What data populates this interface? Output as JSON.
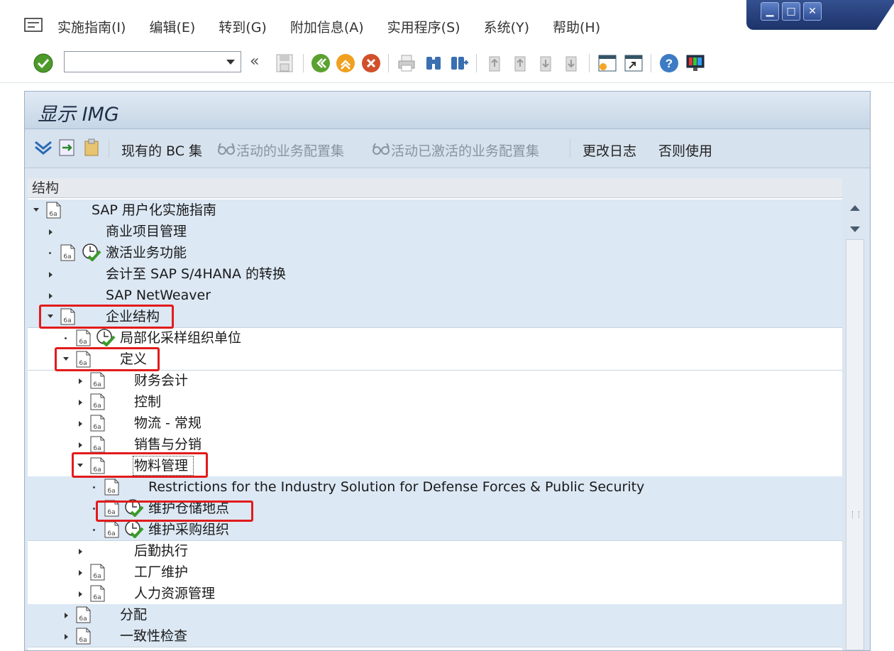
{
  "menubar": {
    "items": [
      {
        "label": "实施指南(I)"
      },
      {
        "label": "编辑(E)"
      },
      {
        "label": "转到(G)"
      },
      {
        "label": "附加信息(A)"
      },
      {
        "label": "实用程序(S)"
      },
      {
        "label": "系统(Y)"
      },
      {
        "label": "帮助(H)"
      }
    ],
    "window_controls": {
      "minimize": "▁",
      "maximize": "□",
      "close": "✕"
    }
  },
  "toolbar": {
    "command_field": {
      "value": "",
      "placeholder": ""
    },
    "back_chevrons": "«"
  },
  "panel": {
    "title": "显示 IMG",
    "app_toolbar": {
      "existing_bc_sets": "现有的 BC 集",
      "active_bc_sets": "活动的业务配置集",
      "activated_bc_sets": "活动已激活的业务配置集",
      "change_log": "更改日志",
      "otherwise_use": "否则使用"
    },
    "tree": {
      "header": "结构",
      "nodes": [
        {
          "label": "SAP 用户化实施指南"
        },
        {
          "label": "商业项目管理"
        },
        {
          "label": "激活业务功能"
        },
        {
          "label": "会计至 SAP S/4HANA 的转换"
        },
        {
          "label": "SAP NetWeaver"
        },
        {
          "label": "企业结构"
        },
        {
          "label": "局部化采样组织单位"
        },
        {
          "label": "定义"
        },
        {
          "label": "财务会计"
        },
        {
          "label": "控制"
        },
        {
          "label": "物流 - 常规"
        },
        {
          "label": "销售与分销"
        },
        {
          "label": "物料管理"
        },
        {
          "label": "Restrictions for the Industry Solution for Defense Forces & Public Security"
        },
        {
          "label": "维护仓储地点"
        },
        {
          "label": "维护采购组织"
        },
        {
          "label": "后勤执行"
        },
        {
          "label": "工厂维护"
        },
        {
          "label": "人力资源管理"
        },
        {
          "label": "分配"
        },
        {
          "label": "一致性检查"
        }
      ]
    }
  },
  "colors": {
    "highlight_box": "#e21b1b",
    "panel_bg": "#dbe6f1",
    "window_controls": "#2e4c92"
  }
}
